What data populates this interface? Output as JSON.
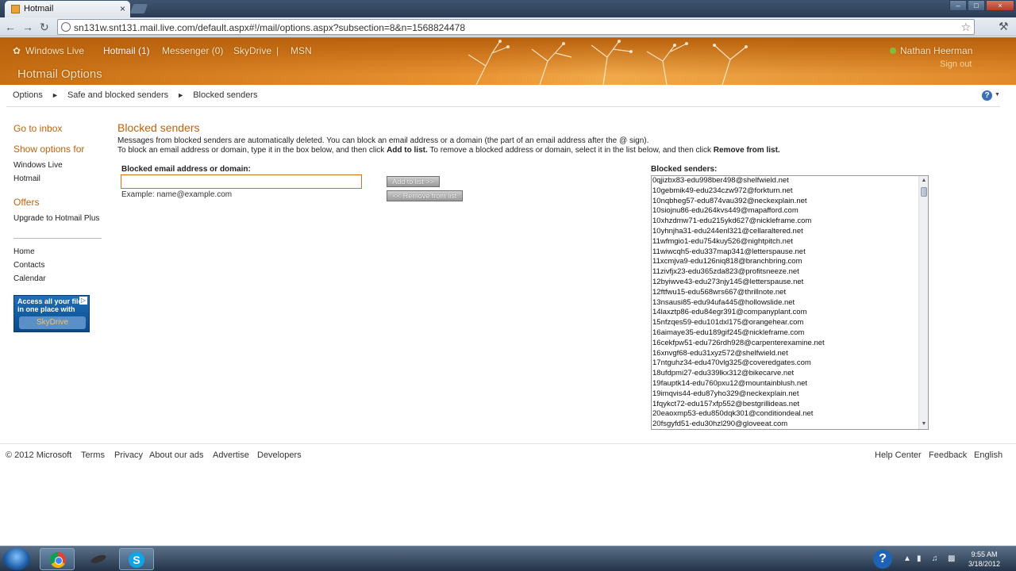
{
  "browser": {
    "tab_title": "Hotmail",
    "tab_close": "×",
    "url": "sn131w.snt131.mail.live.com/default.aspx#!/mail/options.aspx?subsection=8&n=1568824478",
    "window_controls": {
      "minimize": "–",
      "maximize": "□",
      "close": "×"
    }
  },
  "header": {
    "nav": [
      "Windows Live",
      "Hotmail (1)",
      "Messenger (0)",
      "SkyDrive",
      "MSN"
    ],
    "separator": "|",
    "title": "Hotmail Options",
    "user_name": "Nathan Heerman",
    "sign_out": "Sign out",
    "accent": "#e8912f"
  },
  "breadcrumb": {
    "items": [
      "Options",
      "Safe and blocked senders",
      "Blocked senders"
    ],
    "separator": "►"
  },
  "help": {
    "icon": "?",
    "caret": "▼"
  },
  "sidebar": {
    "go_to_inbox": "Go to inbox",
    "show_options_for": "Show options for",
    "options_items": [
      "Windows Live",
      "Hotmail"
    ],
    "offers_heading": "Offers",
    "offers_link": "Upgrade to Hotmail Plus",
    "links": [
      "Home",
      "Contacts",
      "Calendar"
    ],
    "ad": {
      "line1": "Access all your files",
      "line2": "in one place with",
      "button": "SkyDrive"
    }
  },
  "main": {
    "title": "Blocked senders",
    "description_1": "Messages from blocked senders are automatically deleted. You can block an email address or a domain (the part of an email address after the @ sign).",
    "description_2_prefix": "To block an email address or domain, type it in the box below, and then click ",
    "description_2_add": "Add to list.",
    "description_2_mid": " To remove a blocked address or domain, select it in the list below, and then click ",
    "description_2_remove": "Remove from list.",
    "field_label": "Blocked email address or domain:",
    "input_value": "",
    "example": "Example: name@example.com",
    "add_button": "Add to list >>",
    "remove_button": "<< Remove from list",
    "list_label": "Blocked senders:",
    "blocked_senders": [
      "0qjizbx83-edu998ber498@shelfwield.net",
      "10gebmik49-edu234czw972@forkturn.net",
      "10nqbheg57-edu874vau392@neckexplain.net",
      "10siojnu86-edu264kvs449@mapafford.com",
      "10xhzdmw71-edu215ykd627@nickleframe.com",
      "10yhnjha31-edu244enl321@cellaraltered.net",
      "11wfmgio1-edu754kuy526@nightpitch.net",
      "11wiwcqh5-edu337map341@letterspause.net",
      "11xcmjva9-edu126niq818@branchbring.com",
      "11zivfjx23-edu365zda823@profitsneeze.net",
      "12byiwve43-edu273njy145@letterspause.net",
      "12ftfwu15-edu568wrs667@thrillnote.net",
      "13nsausi85-edu94ufa445@hollowslide.net",
      "14laxztp86-edu84egr391@companyplant.com",
      "15nfzqes59-edu101dxl175@orangehear.com",
      "16aimaye35-edu189gif245@nickleframe.com",
      "16cekfpw51-edu726rdh928@carpenterexamine.net",
      "16xnvgf68-edu31xyz572@shelfwield.net",
      "17ntguhz34-edu470vlg325@coveredgates.com",
      "18ufdpmi27-edu339lkx312@bikecarve.net",
      "19fauptk14-edu760pxu12@mountainblush.net",
      "19imqvis44-edu87yho329@neckexplain.net",
      "1fqykct72-edu157xfp552@bestgrillideas.net",
      "20eaoxmp53-edu850dqk301@conditiondeal.net",
      "20fsgyfd51-edu30hzl290@gloveeat.com"
    ]
  },
  "footer": {
    "copyright": "© 2012 Microsoft",
    "links": [
      "Terms",
      "Privacy",
      "About our ads",
      "Advertise",
      "Developers"
    ],
    "right_links": [
      "Help Center",
      "Feedback",
      "English"
    ]
  },
  "taskbar": {
    "time": "9:55 AM",
    "date": "3/18/2012",
    "help": "?"
  }
}
